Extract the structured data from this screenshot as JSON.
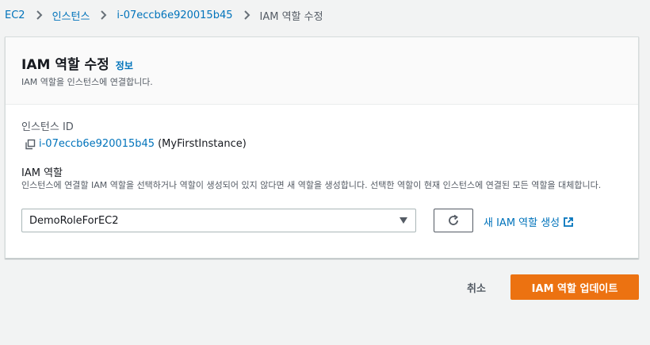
{
  "breadcrumb": {
    "items": [
      {
        "label": "EC2"
      },
      {
        "label": "인스턴스"
      },
      {
        "label": "i-07eccb6e920015b45"
      }
    ],
    "current": "IAM 역할 수정"
  },
  "panel": {
    "title": "IAM 역할 수정",
    "info_link": "정보",
    "description": "IAM 역할을 인스턴스에 연결합니다."
  },
  "instance": {
    "label": "인스턴스 ID",
    "id": "i-07eccb6e920015b45",
    "name": "(MyFirstInstance)"
  },
  "iam_role": {
    "label": "IAM 역할",
    "description": "인스턴스에 연결할 IAM 역할을 선택하거나 역할이 생성되어 있지 않다면 새 역할을 생성합니다. 선택한 역할이 현재 인스턴스에 연결된 모든 역할을 대체합니다.",
    "selected": "DemoRoleForEC2",
    "create_link": "새 IAM 역할 생성"
  },
  "actions": {
    "cancel": "취소",
    "submit": "IAM 역할 업데이트"
  },
  "colors": {
    "link": "#0073bb",
    "primary": "#ec7211",
    "background": "#f2f3f3"
  },
  "icons": [
    "chevron-right-icon",
    "copy-icon",
    "caret-down-icon",
    "refresh-icon",
    "external-link-icon"
  ]
}
